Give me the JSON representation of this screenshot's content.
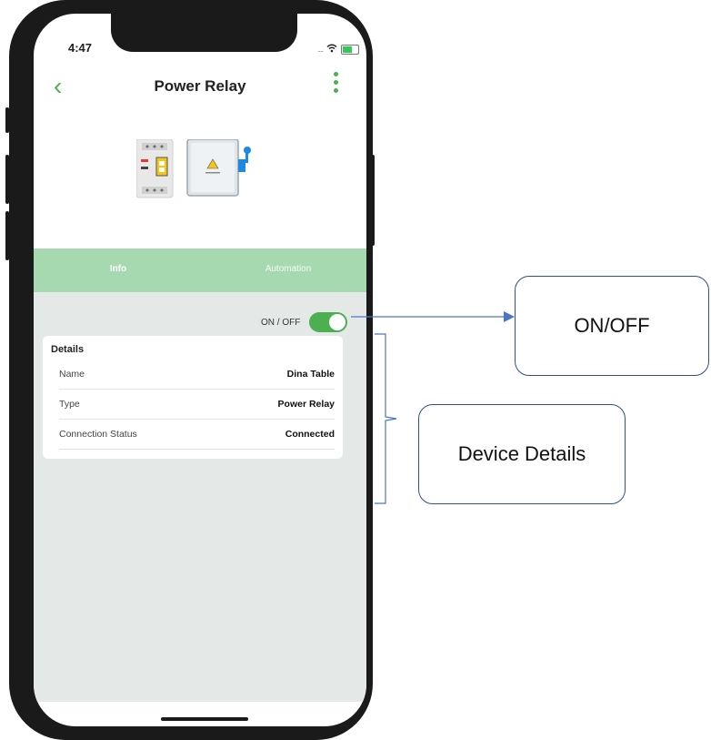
{
  "status_bar": {
    "time": "4:47",
    "signal_dots": "....",
    "wifi_icon": "wifi-icon",
    "battery_icon": "battery-icon"
  },
  "nav": {
    "back_icon": "chevron-left-icon",
    "title": "Power Relay",
    "more_icon": "more-vertical-icon"
  },
  "device_image": {
    "icon": "power-relay-device-icon"
  },
  "tabs": [
    {
      "label": "Info",
      "selected": true
    },
    {
      "label": "Automation",
      "selected": false
    }
  ],
  "power": {
    "label": "ON / OFF",
    "state": true
  },
  "details": {
    "title": "Details",
    "rows": [
      {
        "key": "Name",
        "value": "Dina Table"
      },
      {
        "key": "Type",
        "value": "Power Relay"
      },
      {
        "key": "Connection Status",
        "value": "Connected"
      }
    ]
  },
  "annotations": {
    "onoff_callout": "ON/OFF",
    "details_callout": "Device Details"
  },
  "colors": {
    "accent": "#4caf50",
    "tab_bg": "#a7d9b0",
    "content_bg": "#e4e9e8",
    "callout_border": "#2f4f8f"
  }
}
